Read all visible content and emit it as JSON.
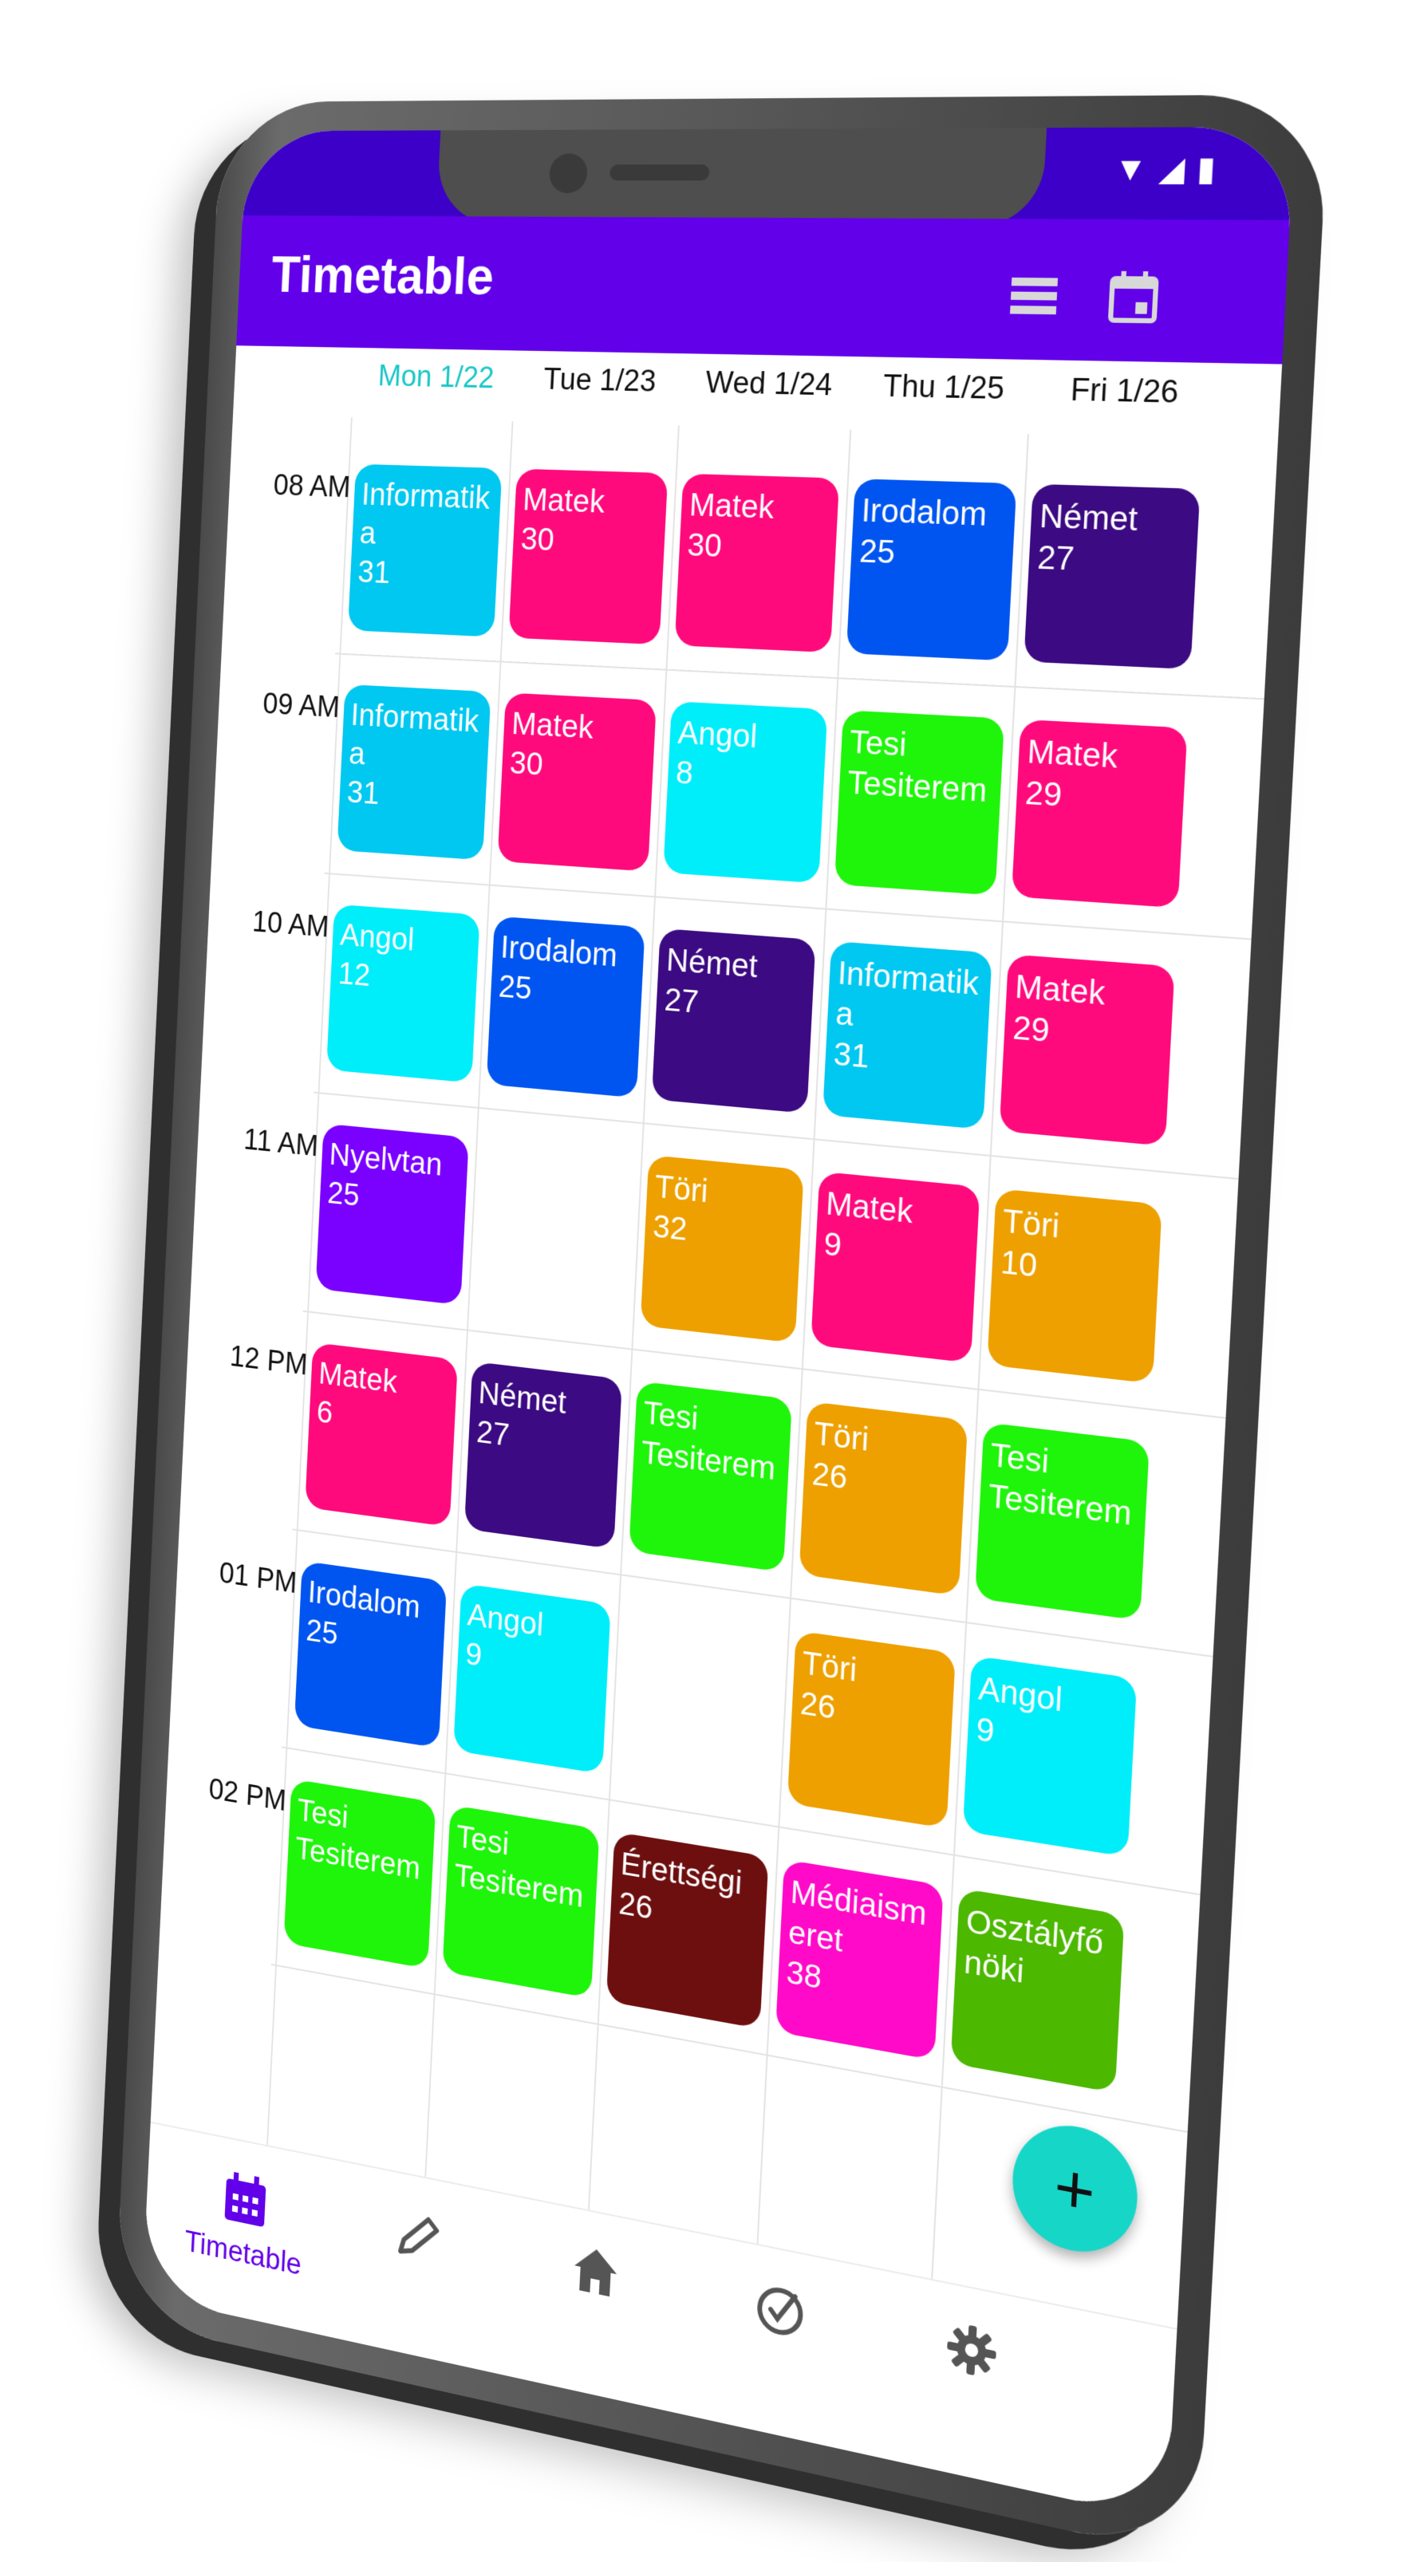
{
  "app": {
    "title": "Timetable"
  },
  "days": [
    {
      "label": "Mon 1/22",
      "today": true
    },
    {
      "label": "Tue 1/23",
      "today": false
    },
    {
      "label": "Wed 1/24",
      "today": false
    },
    {
      "label": "Thu 1/25",
      "today": false
    },
    {
      "label": "Fri 1/26",
      "today": false
    }
  ],
  "times": [
    "08 AM",
    "09 AM",
    "10 AM",
    "11 AM",
    "12 PM",
    "01 PM",
    "02 PM"
  ],
  "colors": {
    "primary": "#6200ea",
    "status": "#3c00c8",
    "accent": "#16d6c8",
    "today": "#19c7c7"
  },
  "lessons": [
    {
      "day": 0,
      "slot": 0,
      "subject": "Informatika",
      "room": "31",
      "color": "#00c8f0"
    },
    {
      "day": 1,
      "slot": 0,
      "subject": "Matek",
      "room": "30",
      "color": "#ff0a7c"
    },
    {
      "day": 2,
      "slot": 0,
      "subject": "Matek",
      "room": "30",
      "color": "#ff0a7c"
    },
    {
      "day": 3,
      "slot": 0,
      "subject": "Irodalom",
      "room": "25",
      "color": "#0055f0"
    },
    {
      "day": 4,
      "slot": 0,
      "subject": "Német",
      "room": "27",
      "color": "#3c0a82"
    },
    {
      "day": 0,
      "slot": 1,
      "subject": "Informatika",
      "room": "31",
      "color": "#00c8f0"
    },
    {
      "day": 1,
      "slot": 1,
      "subject": "Matek",
      "room": "30",
      "color": "#ff0a7c"
    },
    {
      "day": 2,
      "slot": 1,
      "subject": "Angol",
      "room": "8",
      "color": "#00eefa"
    },
    {
      "day": 3,
      "slot": 1,
      "subject": "Tesi",
      "room": "Tesiterem",
      "color": "#1ef50a"
    },
    {
      "day": 4,
      "slot": 1,
      "subject": "Matek",
      "room": "29",
      "color": "#ff0a7c"
    },
    {
      "day": 0,
      "slot": 2,
      "subject": "Angol",
      "room": "12",
      "color": "#00eefa"
    },
    {
      "day": 1,
      "slot": 2,
      "subject": "Irodalom",
      "room": "25",
      "color": "#0055f0"
    },
    {
      "day": 2,
      "slot": 2,
      "subject": "Német",
      "room": "27",
      "color": "#3c0a82"
    },
    {
      "day": 3,
      "slot": 2,
      "subject": "Informatika",
      "room": "31",
      "color": "#00c8f0"
    },
    {
      "day": 4,
      "slot": 2,
      "subject": "Matek",
      "room": "29",
      "color": "#ff0a7c"
    },
    {
      "day": 0,
      "slot": 3,
      "subject": "Nyelvtan",
      "room": "25",
      "color": "#7a00ff"
    },
    {
      "day": 2,
      "slot": 3,
      "subject": "Töri",
      "room": "32",
      "color": "#eea000"
    },
    {
      "day": 3,
      "slot": 3,
      "subject": "Matek",
      "room": "9",
      "color": "#ff0a7c"
    },
    {
      "day": 4,
      "slot": 3,
      "subject": "Töri",
      "room": "10",
      "color": "#eea000"
    },
    {
      "day": 0,
      "slot": 4,
      "subject": "Matek",
      "room": "6",
      "color": "#ff0a7c"
    },
    {
      "day": 1,
      "slot": 4,
      "subject": "Német",
      "room": "27",
      "color": "#3c0a82"
    },
    {
      "day": 2,
      "slot": 4,
      "subject": "Tesi",
      "room": "Tesiterem",
      "color": "#1ef50a"
    },
    {
      "day": 3,
      "slot": 4,
      "subject": "Töri",
      "room": "26",
      "color": "#eea000"
    },
    {
      "day": 4,
      "slot": 4,
      "subject": "Tesi",
      "room": "Tesiterem",
      "color": "#1ef50a"
    },
    {
      "day": 0,
      "slot": 5,
      "subject": "Irodalom",
      "room": "25",
      "color": "#0055f0"
    },
    {
      "day": 1,
      "slot": 5,
      "subject": "Angol",
      "room": "9",
      "color": "#00eefa"
    },
    {
      "day": 3,
      "slot": 5,
      "subject": "Töri",
      "room": "26",
      "color": "#eea000"
    },
    {
      "day": 4,
      "slot": 5,
      "subject": "Angol",
      "room": "9",
      "color": "#00eefa"
    },
    {
      "day": 0,
      "slot": 6,
      "subject": "Tesi",
      "room": "Tesiterem",
      "color": "#1ef50a"
    },
    {
      "day": 1,
      "slot": 6,
      "subject": "Tesi",
      "room": "Tesiterem",
      "color": "#1ef50a"
    },
    {
      "day": 2,
      "slot": 6,
      "subject": "Érettségi",
      "room": "26",
      "color": "#6e0f0f"
    },
    {
      "day": 3,
      "slot": 6,
      "subject": "Médiaismeret",
      "room": "38",
      "color": "#ff0ac8"
    },
    {
      "day": 4,
      "slot": 6,
      "subject": "Osztályfőnöki",
      "room": "",
      "color": "#4cb800"
    }
  ],
  "fab": {
    "label": "+"
  },
  "bottom_nav": [
    {
      "icon": "calendar-icon",
      "label": "Timetable",
      "active": true
    },
    {
      "icon": "pencil-icon",
      "label": "",
      "active": false
    },
    {
      "icon": "home-icon",
      "label": "",
      "active": false
    },
    {
      "icon": "check-circle-icon",
      "label": "",
      "active": false
    },
    {
      "icon": "gear-icon",
      "label": "",
      "active": false
    }
  ]
}
